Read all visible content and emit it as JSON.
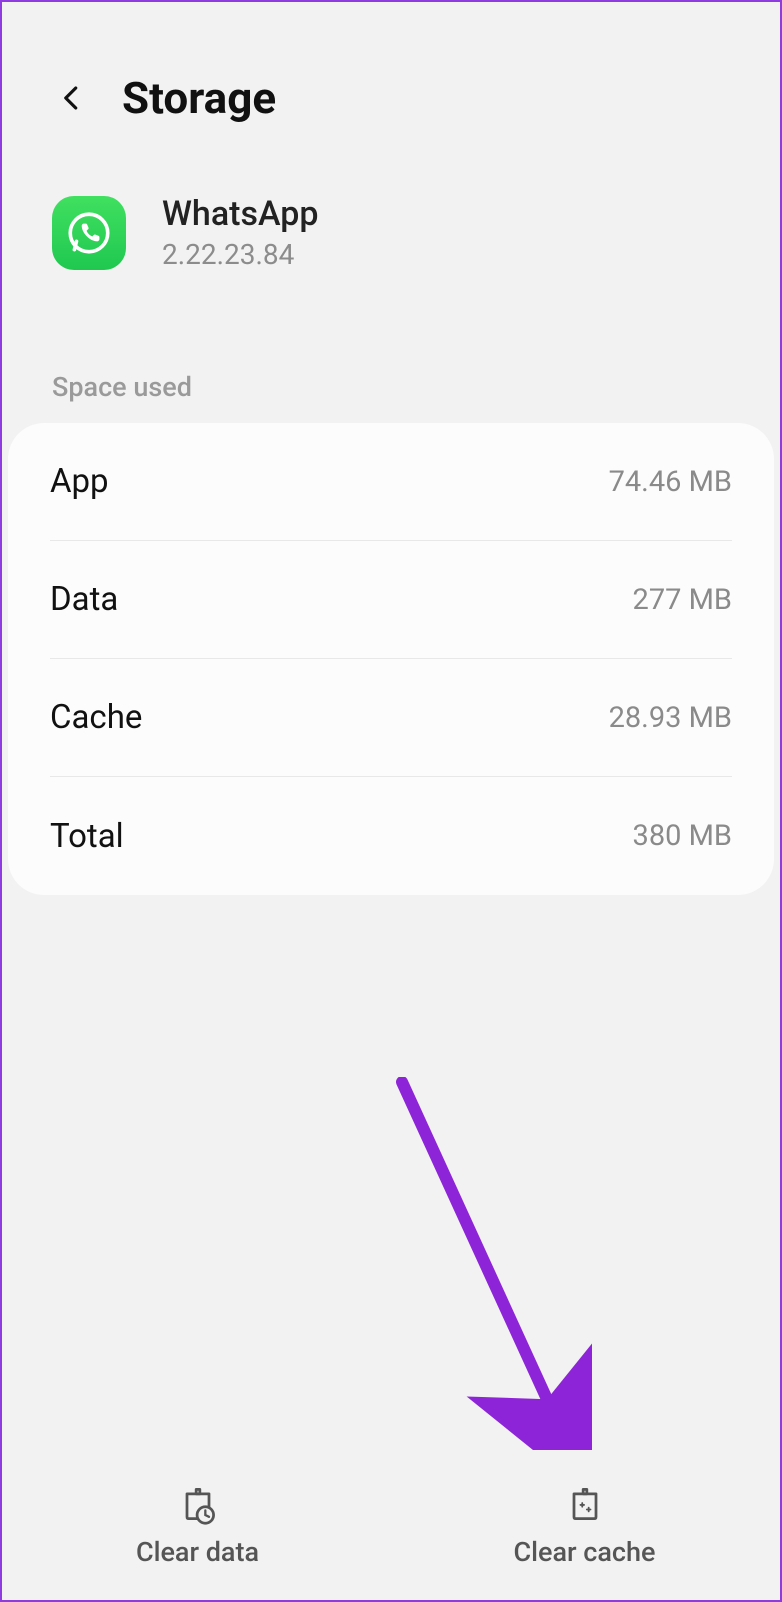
{
  "header": {
    "title": "Storage"
  },
  "app": {
    "name": "WhatsApp",
    "version": "2.22.23.84"
  },
  "section": {
    "label": "Space used"
  },
  "rows": {
    "app": {
      "label": "App",
      "value": "74.46 MB"
    },
    "data": {
      "label": "Data",
      "value": "277 MB"
    },
    "cache": {
      "label": "Cache",
      "value": "28.93 MB"
    },
    "total": {
      "label": "Total",
      "value": "380 MB"
    }
  },
  "bottom": {
    "clear_data": "Clear data",
    "clear_cache": "Clear cache"
  },
  "annotation": {
    "arrow_color": "#8e24d8"
  }
}
